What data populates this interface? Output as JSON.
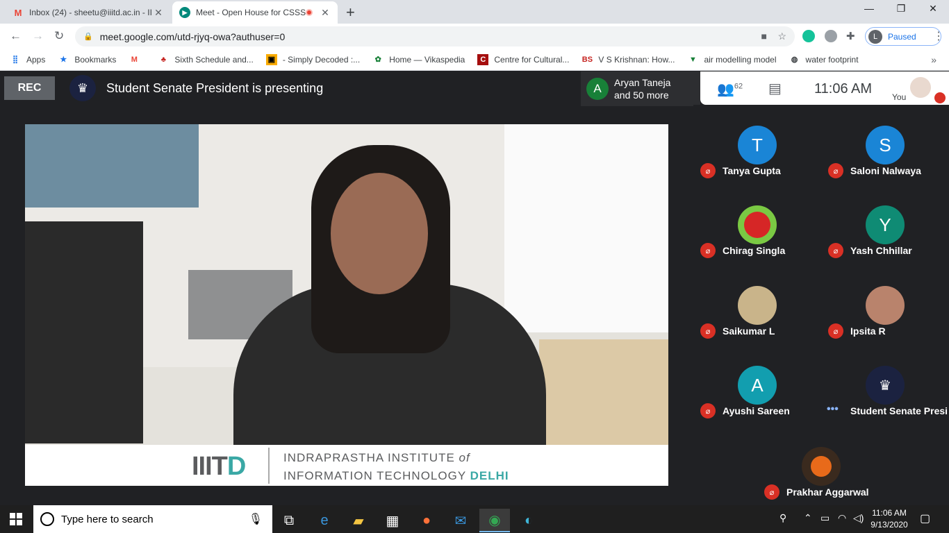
{
  "browser": {
    "tabs": [
      {
        "title": "Inbox (24) - sheetu@iiitd.ac.in - II",
        "icon": "gmail-icon"
      },
      {
        "title": "Meet - Open House for CSSS",
        "icon": "meet-icon",
        "recording": true
      }
    ],
    "address": "meet.google.com/utd-rjyq-owa?authuser=0",
    "profile_letter": "L",
    "profile_status": "Paused"
  },
  "bookmarks": [
    {
      "label": "Apps",
      "icon": "apps-icon"
    },
    {
      "label": "Bookmarks",
      "icon": "star-icon"
    },
    {
      "label": "",
      "icon": "gmail-icon"
    },
    {
      "label": "Sixth Schedule and...",
      "icon": "bookmark-icon"
    },
    {
      "label": "- Simply Decoded :...",
      "icon": "bookmark-icon"
    },
    {
      "label": "Home — Vikaspedia",
      "icon": "bookmark-icon"
    },
    {
      "label": "Centre for Cultural...",
      "icon": "bookmark-icon"
    },
    {
      "label": "V S Krishnan: How...",
      "icon": "bookmark-icon"
    },
    {
      "label": "air modelling model",
      "icon": "bookmark-icon"
    },
    {
      "label": "water footprint",
      "icon": "bookmark-icon"
    }
  ],
  "meet": {
    "rec_label": "REC",
    "presenting_text": "Student Senate President is presenting",
    "joined_initial": "A",
    "joined_line1": "Aryan Taneja",
    "joined_line2": "and 50 more",
    "people_count": "62",
    "time": "11:06 AM",
    "you_label": "You"
  },
  "banner": {
    "logo_text": "IIIT",
    "logo_accent": "D",
    "line1": "INDRAPRASTHA INSTITUTE ",
    "line1_of": "of",
    "line2": "INFORMATION TECHNOLOGY ",
    "line2_accent": "DELHI"
  },
  "participants": [
    {
      "name": "Tanya Gupta",
      "initial": "T",
      "color": "#1a85d6",
      "muted": true
    },
    {
      "name": "Saloni Nalwaya",
      "initial": "S",
      "color": "#1a85d6",
      "muted": true
    },
    {
      "name": "Chirag Singla",
      "initial": "",
      "color": "#7ac943",
      "muted": true
    },
    {
      "name": "Yash Chhillar",
      "initial": "Y",
      "color": "#0f8b74",
      "muted": true
    },
    {
      "name": "Saikumar L",
      "initial": "",
      "color": "#c9b48a",
      "muted": true
    },
    {
      "name": "Ipsita R",
      "initial": "",
      "color": "#b9836c",
      "muted": true
    },
    {
      "name": "Ayushi Sareen",
      "initial": "A",
      "color": "#129eaf",
      "muted": true
    },
    {
      "name": "Student Senate Presi...",
      "initial": "",
      "color": "#1b2240",
      "muted": false
    },
    {
      "name": "Prakhar Aggarwal",
      "initial": "",
      "color": "#3a2a1e",
      "muted": true
    }
  ],
  "taskbar": {
    "search_placeholder": "Type here to search",
    "time": "11:06 AM",
    "date": "9/13/2020"
  },
  "colors": {
    "meet_bg": "#202124",
    "mute_red": "#d93025",
    "accent_teal": "#3aa8a5"
  }
}
